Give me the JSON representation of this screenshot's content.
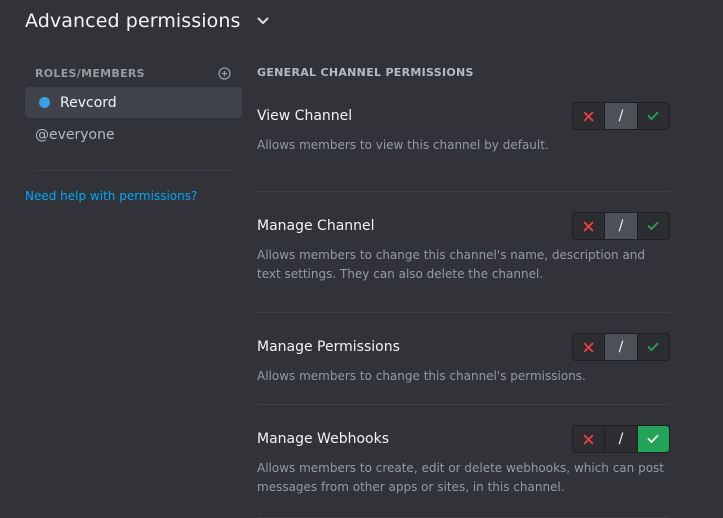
{
  "header": {
    "title": "Advanced permissions"
  },
  "sidebar": {
    "section_title": "ROLES/MEMBERS",
    "roles": [
      {
        "label": "Revcord",
        "color": "#3aa0e6"
      },
      {
        "label": "@everyone"
      }
    ],
    "help_link": "Need help with permissions?"
  },
  "content": {
    "section_title": "GENERAL CHANNEL PERMISSIONS",
    "permissions": [
      {
        "name": "View Channel",
        "description": "Allows members to view this channel by default.",
        "state": "neutral"
      },
      {
        "name": "Manage Channel",
        "description": "Allows members to change this channel's name, description and text settings. They can also delete the channel.",
        "state": "neutral"
      },
      {
        "name": "Manage Permissions",
        "description": "Allows members to change this channel's permissions.",
        "state": "neutral"
      },
      {
        "name": "Manage Webhooks",
        "description": "Allows members to create, edit or delete webhooks, which can post messages from other apps or sites, in this channel.",
        "state": "allow"
      }
    ]
  },
  "toggle": {
    "neutral_symbol": "/"
  },
  "colors": {
    "background": "#313338",
    "deny": "#f23f43",
    "allow": "#23a559",
    "link": "#00a8fc",
    "role_dot": "#3aa0e6"
  }
}
